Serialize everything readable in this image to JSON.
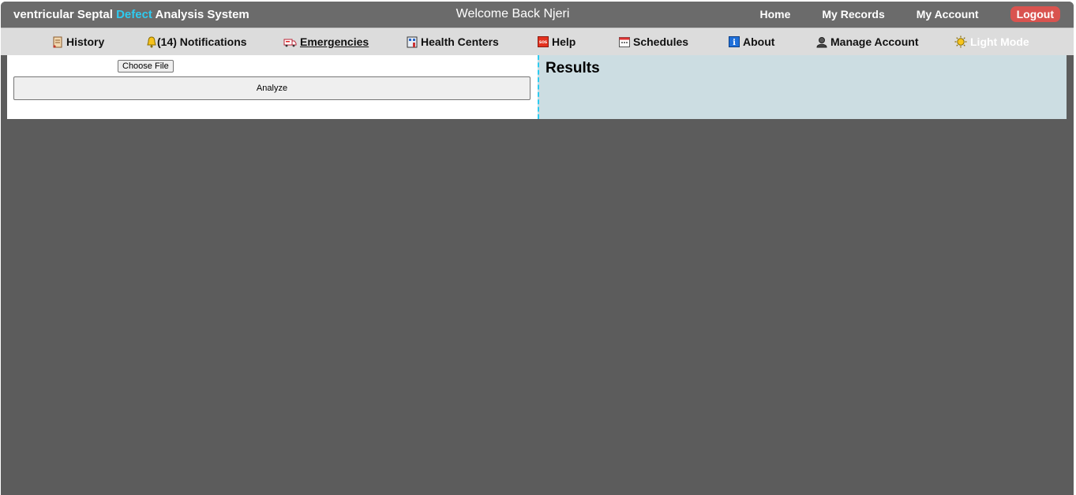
{
  "brand": {
    "part1": "ventricular Septal ",
    "accent": "Defect",
    "part2": " Analysis System",
    "accent_color": "#2ecbf0"
  },
  "welcome": "Welcome Back Njeri",
  "toplinks": {
    "home": "Home",
    "records": "My Records",
    "account": "My Account",
    "logout": "Logout"
  },
  "nav": {
    "history": "History",
    "notifications": "(14) Notifications",
    "emergencies": "Emergencies",
    "health_centers": "Health Centers",
    "help": "Help",
    "schedules": "Schedules",
    "about": "About",
    "manage_account": "Manage Account",
    "light_mode": "Light Mode"
  },
  "upload": {
    "choose_label": "Choose File",
    "analyze_label": "Analyze"
  },
  "results": {
    "title": "Results"
  },
  "colors": {
    "topbar": "#6b6b6b",
    "navbar": "#dcdcdc",
    "background": "#5c5c5c",
    "results_panel": "#ccdde2",
    "logout": "#d9534f"
  }
}
